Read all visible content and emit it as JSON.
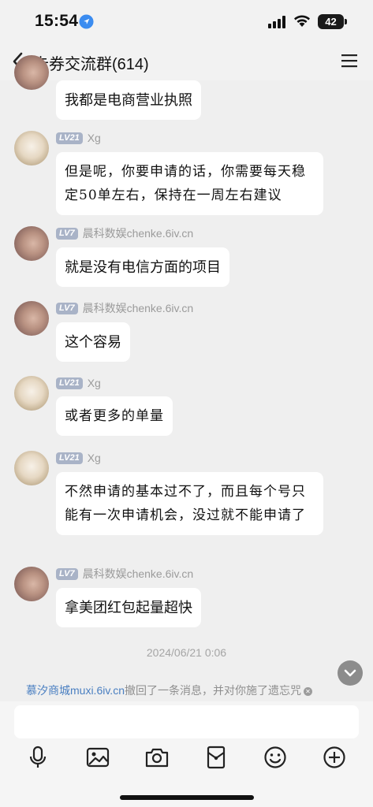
{
  "status_bar": {
    "time": "15:54",
    "battery": "42"
  },
  "header": {
    "title": "卡券交流群(614)"
  },
  "messages": [
    {
      "avatar": "hand",
      "text": "我都是电商营业执照"
    },
    {
      "avatar": "cat",
      "level": "LV21",
      "sender": "Xg",
      "text": "但是呢，你要申请的话，你需要每天稳定50单左右，保持在一周左右建议"
    },
    {
      "avatar": "hand",
      "level": "LV7",
      "sender": "晨科数娱chenke.6iv.cn",
      "text": "就是没有电信方面的项目"
    },
    {
      "avatar": "hand",
      "level": "LV7",
      "sender": "晨科数娱chenke.6iv.cn",
      "text": "这个容易"
    },
    {
      "avatar": "cat",
      "level": "LV21",
      "sender": "Xg",
      "text": "或者更多的单量"
    },
    {
      "avatar": "cat",
      "level": "LV21",
      "sender": "Xg",
      "text": "不然申请的基本过不了，而且每个号只能有一次申请机会，没过就不能申请了"
    },
    {
      "avatar": "hand",
      "level": "LV7",
      "sender": "晨科数娱chenke.6iv.cn",
      "text": "拿美团红包起量超快"
    }
  ],
  "timestamp": "2024/06/21 0:06",
  "recall_notice": {
    "user": "慕汐商城muxi.6iv.cn",
    "text": "撤回了一条消息，并对你施了遗忘咒"
  },
  "input": {
    "placeholder": ""
  },
  "toolbar": [
    "mic-icon",
    "image-icon",
    "camera-icon",
    "red-packet-icon",
    "emoji-icon",
    "plus-icon"
  ]
}
